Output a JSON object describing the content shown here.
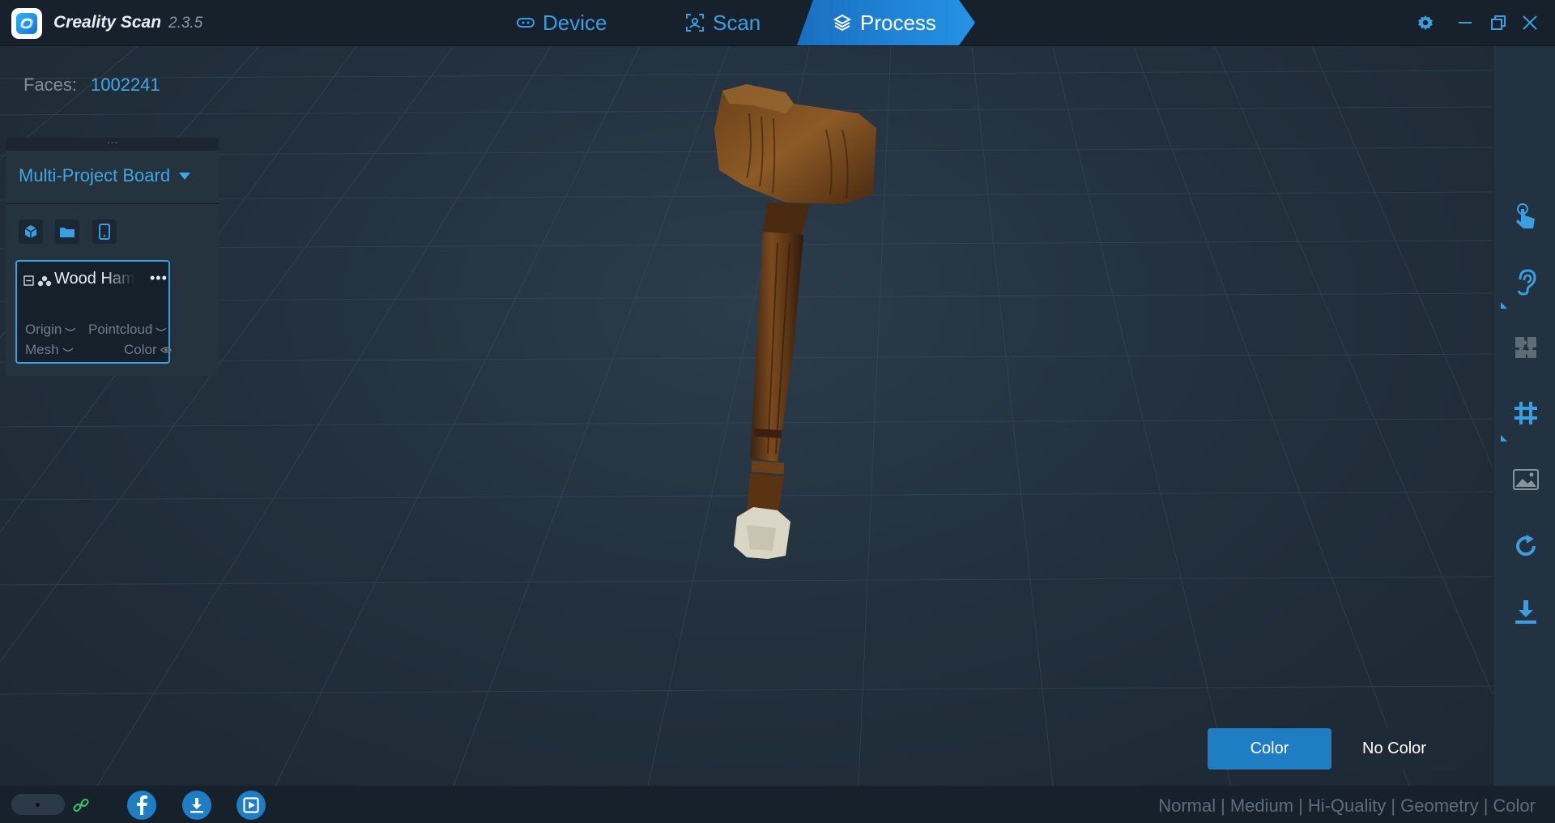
{
  "app": {
    "name": "Creality Scan",
    "version": "2.3.5"
  },
  "nav": {
    "tabs": [
      {
        "label": "Device",
        "icon": "device-icon"
      },
      {
        "label": "Scan",
        "icon": "scan-icon"
      },
      {
        "label": "Process",
        "icon": "layers-icon",
        "active": true
      }
    ]
  },
  "window_controls": [
    "settings-icon",
    "minimize-icon",
    "restore-icon",
    "close-icon"
  ],
  "viewport": {
    "faces_label": "Faces:",
    "faces_value": "1002241"
  },
  "panel": {
    "board_label": "Multi-Project Board",
    "icons": [
      "cube-icon",
      "folder-icon",
      "phone-icon"
    ],
    "project": {
      "name": "Wood Hammer",
      "more": "•••",
      "layers": {
        "origin": "Origin",
        "pointcloud": "Pointcloud",
        "mesh": "Mesh",
        "color": "Color"
      }
    }
  },
  "color_mode": {
    "color_label": "Color",
    "no_color_label": "No Color",
    "selected": "Color"
  },
  "right_toolbar": [
    "touch-icon",
    "ear-icon",
    "puzzle-icon",
    "grid-icon",
    "image-icon",
    "rotate-icon",
    "download-icon"
  ],
  "status": {
    "social": [
      "facebook-icon",
      "download-icon",
      "video-icon"
    ],
    "quality": {
      "normal": "Normal",
      "medium": "Medium",
      "hi_quality": "Hi-Quality",
      "geometry": "Geometry",
      "color": "Color",
      "separator": "|"
    }
  },
  "colors": {
    "accent": "#3b9ee0",
    "active_tab": "#1f7dc3",
    "background": "#1f2d3a"
  }
}
